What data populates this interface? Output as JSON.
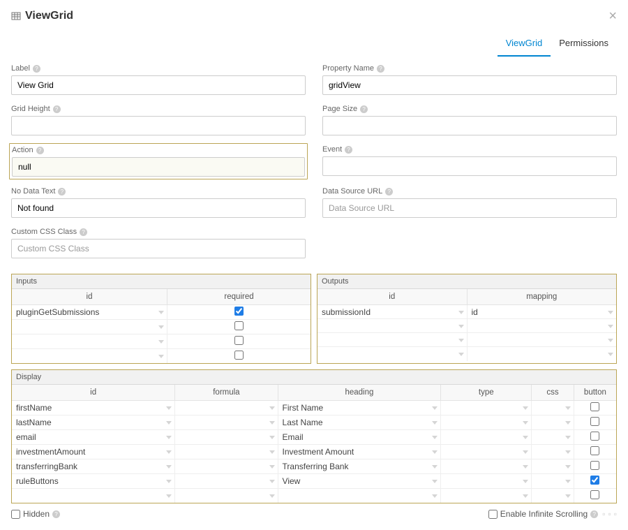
{
  "header": {
    "title": "ViewGrid"
  },
  "tabs": {
    "active": "ViewGrid",
    "other": "Permissions"
  },
  "fields": {
    "label": {
      "label": "Label",
      "value": "View Grid"
    },
    "property": {
      "label": "Property Name",
      "value": "gridView"
    },
    "gridHeight": {
      "label": "Grid Height",
      "value": ""
    },
    "pageSize": {
      "label": "Page Size",
      "value": ""
    },
    "action": {
      "label": "Action",
      "value": "null"
    },
    "event": {
      "label": "Event",
      "value": ""
    },
    "noData": {
      "label": "No Data Text",
      "value": "Not found"
    },
    "dataSource": {
      "label": "Data Source URL",
      "placeholder": "Data Source URL",
      "value": ""
    },
    "cssClass": {
      "label": "Custom CSS Class",
      "placeholder": "Custom CSS Class",
      "value": ""
    }
  },
  "inputs": {
    "title": "Inputs",
    "headers": {
      "id": "id",
      "required": "required"
    },
    "rows": [
      {
        "id": "pluginGetSubmissions",
        "required": true
      },
      {
        "id": "",
        "required": false
      },
      {
        "id": "",
        "required": false
      },
      {
        "id": "",
        "required": false
      }
    ]
  },
  "outputs": {
    "title": "Outputs",
    "headers": {
      "id": "id",
      "mapping": "mapping"
    },
    "rows": [
      {
        "id": "submissionId",
        "mapping": "id"
      },
      {
        "id": "",
        "mapping": ""
      },
      {
        "id": "",
        "mapping": ""
      },
      {
        "id": "",
        "mapping": ""
      }
    ]
  },
  "display": {
    "title": "Display",
    "headers": {
      "id": "id",
      "formula": "formula",
      "heading": "heading",
      "type": "type",
      "css": "css",
      "button": "button"
    },
    "rows": [
      {
        "id": "firstName",
        "formula": "",
        "heading": "First Name",
        "type": "",
        "css": "",
        "button": false
      },
      {
        "id": "lastName",
        "formula": "",
        "heading": "Last Name",
        "type": "",
        "css": "",
        "button": false
      },
      {
        "id": "email",
        "formula": "",
        "heading": "Email",
        "type": "",
        "css": "",
        "button": false
      },
      {
        "id": "investmentAmount",
        "formula": "",
        "heading": "Investment Amount",
        "type": "",
        "css": "",
        "button": false
      },
      {
        "id": "transferringBank",
        "formula": "",
        "heading": "Transferring Bank",
        "type": "",
        "css": "",
        "button": false
      },
      {
        "id": "ruleButtons",
        "formula": "",
        "heading": "View",
        "type": "",
        "css": "",
        "button": true
      },
      {
        "id": "",
        "formula": "",
        "heading": "",
        "type": "",
        "css": "",
        "button": false
      }
    ]
  },
  "footer": {
    "hidden": {
      "label": "Hidden",
      "checked": false
    },
    "infinite": {
      "label": "Enable Infinite Scrolling",
      "checked": false
    }
  }
}
